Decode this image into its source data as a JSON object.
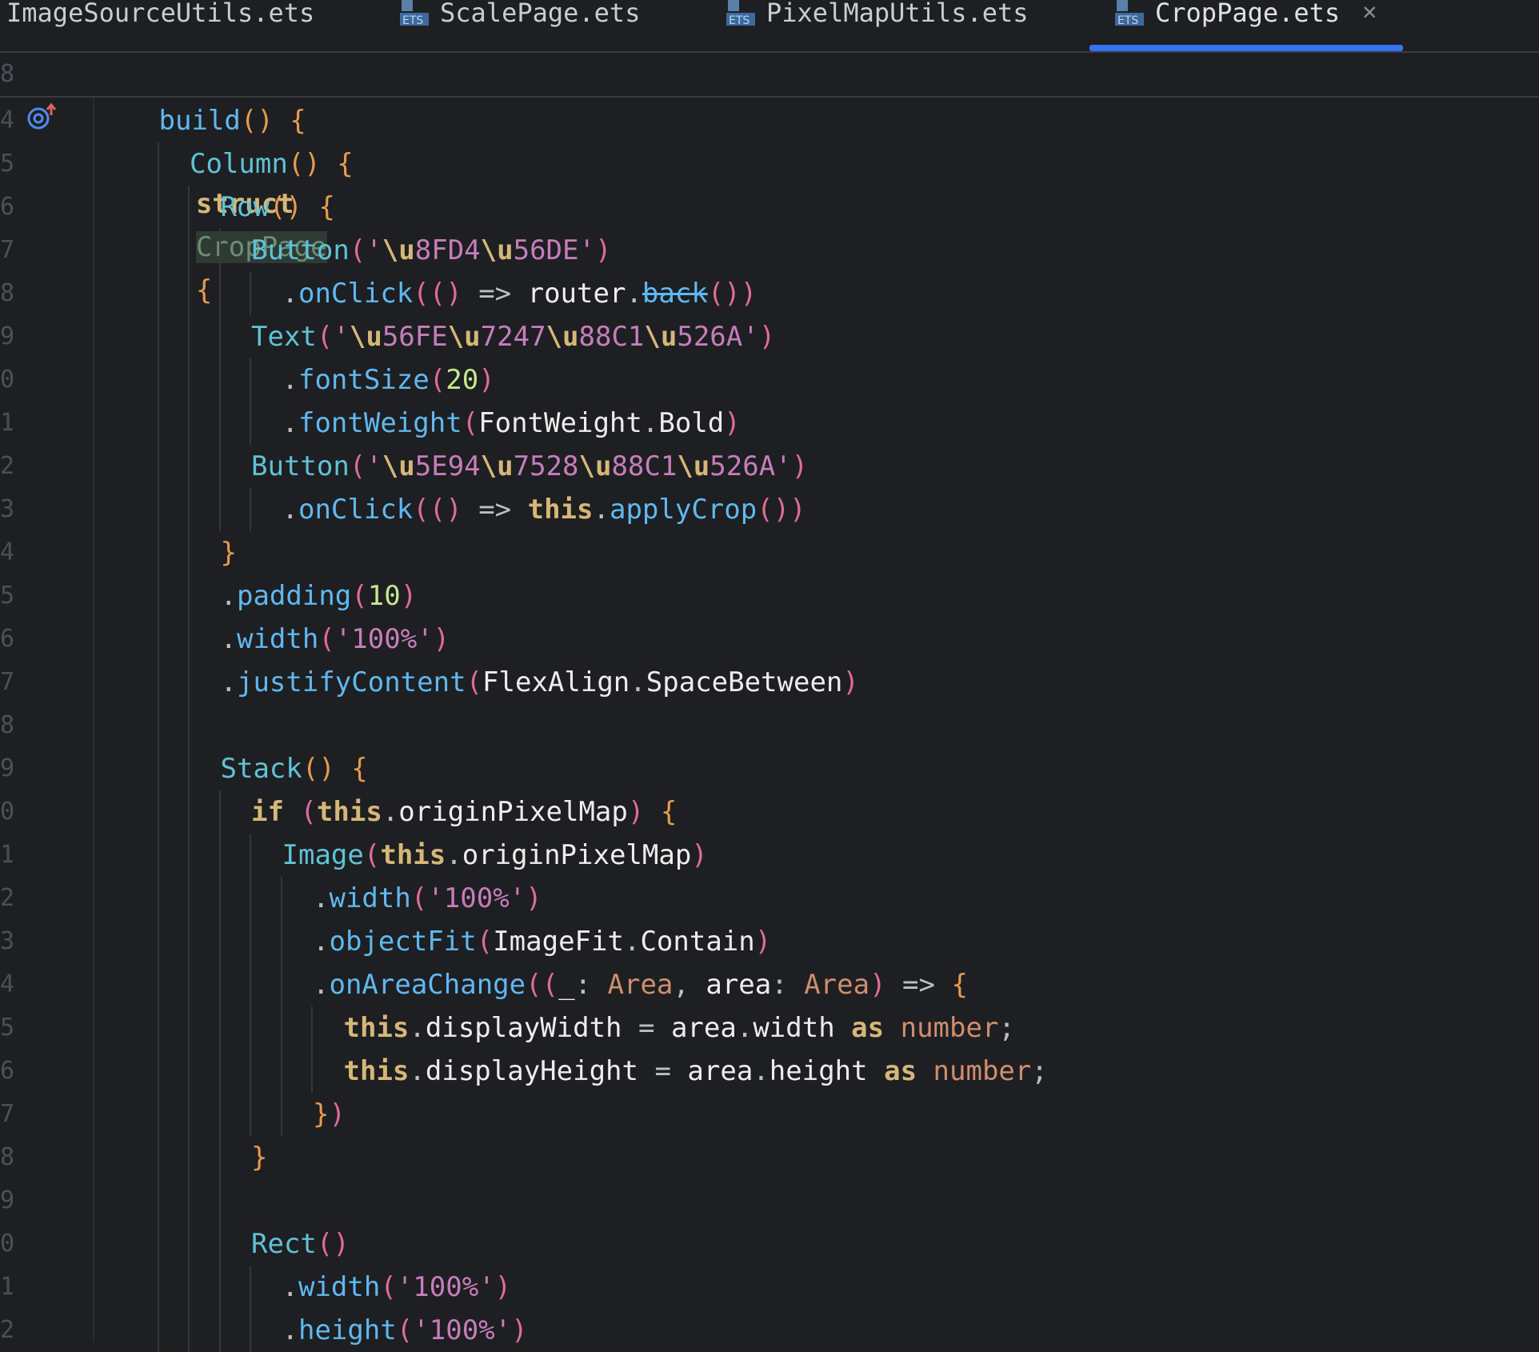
{
  "tabs": [
    {
      "label": "ImageSourceUtils.ets",
      "active": false
    },
    {
      "label": "ScalePage.ets",
      "active": false
    },
    {
      "label": "PixelMapUtils.ets",
      "active": false
    },
    {
      "label": "CropPage.ets",
      "active": true
    }
  ],
  "icons": {
    "file": "ets-file-icon",
    "close": "close-icon",
    "gutter": "implemented-method-icon"
  },
  "colors": {
    "accent": "#3574f0",
    "background": "#1e1f22"
  },
  "sticky": {
    "line_number": "8",
    "keyword": "struct",
    "name": "CropPage",
    "brace": "{"
  },
  "lines": [
    {
      "n": "4",
      "indent": 1,
      "tokens": [
        [
          "build",
          "mt"
        ],
        [
          "()",
          "br1"
        ],
        [
          " ",
          ""
        ],
        [
          "{",
          "br1"
        ]
      ]
    },
    {
      "n": "5",
      "indent": 2,
      "tokens": [
        [
          "Column",
          "cl"
        ],
        [
          "()",
          "br1"
        ],
        [
          " ",
          ""
        ],
        [
          "{",
          "br1"
        ]
      ]
    },
    {
      "n": "6",
      "indent": 3,
      "tokens": [
        [
          "Row",
          "cl"
        ],
        [
          "()",
          "br1"
        ],
        [
          " ",
          ""
        ],
        [
          "{",
          "br1"
        ]
      ]
    },
    {
      "n": "7",
      "indent": 4,
      "tokens": [
        [
          "Button",
          "cl"
        ],
        [
          "(",
          "br2"
        ],
        [
          "'",
          "str"
        ],
        [
          "\\u",
          "esc"
        ],
        [
          "8FD4",
          "str"
        ],
        [
          "\\u",
          "esc"
        ],
        [
          "56DE",
          "str"
        ],
        [
          "'",
          "str"
        ],
        [
          ")",
          "br2"
        ]
      ]
    },
    {
      "n": "8",
      "indent": 5,
      "tokens": [
        [
          ".",
          "op"
        ],
        [
          "onClick",
          "mt"
        ],
        [
          "((",
          "br2"
        ],
        [
          ")",
          "br2"
        ],
        [
          " => ",
          ""
        ],
        [
          "router",
          "id"
        ],
        [
          ".",
          "op"
        ],
        [
          "back",
          "dep"
        ],
        [
          "())",
          "br2"
        ]
      ]
    },
    {
      "n": "9",
      "indent": 4,
      "tokens": [
        [
          "Text",
          "cl"
        ],
        [
          "(",
          "br2"
        ],
        [
          "'",
          "str"
        ],
        [
          "\\u",
          "esc"
        ],
        [
          "56FE",
          "str"
        ],
        [
          "\\u",
          "esc"
        ],
        [
          "7247",
          "str"
        ],
        [
          "\\u",
          "esc"
        ],
        [
          "88C1",
          "str"
        ],
        [
          "\\u",
          "esc"
        ],
        [
          "526A",
          "str"
        ],
        [
          "'",
          "str"
        ],
        [
          ")",
          "br2"
        ]
      ]
    },
    {
      "n": "0",
      "indent": 5,
      "tokens": [
        [
          ".",
          "op"
        ],
        [
          "fontSize",
          "mt"
        ],
        [
          "(",
          "br2"
        ],
        [
          "20",
          "num"
        ],
        [
          ")",
          "br2"
        ]
      ]
    },
    {
      "n": "1",
      "indent": 5,
      "tokens": [
        [
          ".",
          "op"
        ],
        [
          "fontWeight",
          "mt"
        ],
        [
          "(",
          "br2"
        ],
        [
          "FontWeight",
          "id"
        ],
        [
          ".",
          "op"
        ],
        [
          "Bold",
          "id"
        ],
        [
          ")",
          "br2"
        ]
      ]
    },
    {
      "n": "2",
      "indent": 4,
      "tokens": [
        [
          "Button",
          "cl"
        ],
        [
          "(",
          "br2"
        ],
        [
          "'",
          "str"
        ],
        [
          "\\u",
          "esc"
        ],
        [
          "5E94",
          "str"
        ],
        [
          "\\u",
          "esc"
        ],
        [
          "7528",
          "str"
        ],
        [
          "\\u",
          "esc"
        ],
        [
          "88C1",
          "str"
        ],
        [
          "\\u",
          "esc"
        ],
        [
          "526A",
          "str"
        ],
        [
          "'",
          "str"
        ],
        [
          ")",
          "br2"
        ]
      ]
    },
    {
      "n": "3",
      "indent": 5,
      "tokens": [
        [
          ".",
          "op"
        ],
        [
          "onClick",
          "mt"
        ],
        [
          "((",
          "br2"
        ],
        [
          ")",
          "br2"
        ],
        [
          " => ",
          ""
        ],
        [
          "this",
          "kw"
        ],
        [
          ".",
          "op"
        ],
        [
          "applyCrop",
          "mt"
        ],
        [
          "())",
          "br2"
        ]
      ]
    },
    {
      "n": "4",
      "indent": 3,
      "tokens": [
        [
          "}",
          "br1"
        ]
      ]
    },
    {
      "n": "5",
      "indent": 3,
      "tokens": [
        [
          ".",
          "op"
        ],
        [
          "padding",
          "mt"
        ],
        [
          "(",
          "br2"
        ],
        [
          "10",
          "num"
        ],
        [
          ")",
          "br2"
        ]
      ]
    },
    {
      "n": "6",
      "indent": 3,
      "tokens": [
        [
          ".",
          "op"
        ],
        [
          "width",
          "mt"
        ],
        [
          "(",
          "br2"
        ],
        [
          "'100%'",
          "str"
        ],
        [
          ")",
          "br2"
        ]
      ]
    },
    {
      "n": "7",
      "indent": 3,
      "tokens": [
        [
          ".",
          "op"
        ],
        [
          "justifyContent",
          "mt"
        ],
        [
          "(",
          "br2"
        ],
        [
          "FlexAlign",
          "id"
        ],
        [
          ".",
          "op"
        ],
        [
          "SpaceBetween",
          "id"
        ],
        [
          ")",
          "br2"
        ]
      ]
    },
    {
      "n": "8",
      "indent": 3,
      "tokens": []
    },
    {
      "n": "9",
      "indent": 3,
      "tokens": [
        [
          "Stack",
          "cl"
        ],
        [
          "()",
          "br1"
        ],
        [
          " ",
          ""
        ],
        [
          "{",
          "br1"
        ]
      ]
    },
    {
      "n": "0",
      "indent": 4,
      "tokens": [
        [
          "if",
          "kw"
        ],
        [
          " ",
          ""
        ],
        [
          "(",
          "br2"
        ],
        [
          "this",
          "kw"
        ],
        [
          ".",
          "op"
        ],
        [
          "originPixelMap",
          "id"
        ],
        [
          ")",
          "br2"
        ],
        [
          " ",
          ""
        ],
        [
          "{",
          "br1"
        ]
      ]
    },
    {
      "n": "1",
      "indent": 5,
      "tokens": [
        [
          "Image",
          "cl"
        ],
        [
          "(",
          "br2"
        ],
        [
          "this",
          "kw"
        ],
        [
          ".",
          "op"
        ],
        [
          "originPixelMap",
          "id"
        ],
        [
          ")",
          "br2"
        ]
      ]
    },
    {
      "n": "2",
      "indent": 6,
      "tokens": [
        [
          ".",
          "op"
        ],
        [
          "width",
          "mt"
        ],
        [
          "(",
          "br2"
        ],
        [
          "'100%'",
          "str"
        ],
        [
          ")",
          "br2"
        ]
      ]
    },
    {
      "n": "3",
      "indent": 6,
      "tokens": [
        [
          ".",
          "op"
        ],
        [
          "objectFit",
          "mt"
        ],
        [
          "(",
          "br2"
        ],
        [
          "ImageFit",
          "id"
        ],
        [
          ".",
          "op"
        ],
        [
          "Contain",
          "id"
        ],
        [
          ")",
          "br2"
        ]
      ]
    },
    {
      "n": "4",
      "indent": 6,
      "tokens": [
        [
          ".",
          "op"
        ],
        [
          "onAreaChange",
          "mt"
        ],
        [
          "((",
          "br2"
        ],
        [
          "_",
          "id"
        ],
        [
          ": ",
          ""
        ],
        [
          "Area",
          "ty"
        ],
        [
          ", ",
          ""
        ],
        [
          "area",
          "id"
        ],
        [
          ": ",
          ""
        ],
        [
          "Area",
          "ty"
        ],
        [
          ")",
          "br2"
        ],
        [
          " => ",
          ""
        ],
        [
          "{",
          "br1"
        ]
      ]
    },
    {
      "n": "5",
      "indent": 7,
      "tokens": [
        [
          "this",
          "kw"
        ],
        [
          ".",
          "op"
        ],
        [
          "displayWidth",
          "id"
        ],
        [
          " = ",
          ""
        ],
        [
          "area",
          "id"
        ],
        [
          ".",
          "op"
        ],
        [
          "width",
          "id"
        ],
        [
          " ",
          ""
        ],
        [
          "as",
          "kw"
        ],
        [
          " ",
          ""
        ],
        [
          "number",
          "ty"
        ],
        [
          ";",
          ""
        ]
      ]
    },
    {
      "n": "6",
      "indent": 7,
      "tokens": [
        [
          "this",
          "kw"
        ],
        [
          ".",
          "op"
        ],
        [
          "displayHeight",
          "id"
        ],
        [
          " = ",
          ""
        ],
        [
          "area",
          "id"
        ],
        [
          ".",
          "op"
        ],
        [
          "height",
          "id"
        ],
        [
          " ",
          ""
        ],
        [
          "as",
          "kw"
        ],
        [
          " ",
          ""
        ],
        [
          "number",
          "ty"
        ],
        [
          ";",
          ""
        ]
      ]
    },
    {
      "n": "7",
      "indent": 6,
      "tokens": [
        [
          "}",
          "br1"
        ],
        [
          ")",
          "br2"
        ]
      ]
    },
    {
      "n": "8",
      "indent": 4,
      "tokens": [
        [
          "}",
          "br1"
        ]
      ]
    },
    {
      "n": "9",
      "indent": 4,
      "tokens": []
    },
    {
      "n": "0",
      "indent": 4,
      "tokens": [
        [
          "Rect",
          "cl"
        ],
        [
          "()",
          "br2"
        ]
      ]
    },
    {
      "n": "1",
      "indent": 5,
      "tokens": [
        [
          ".",
          "op"
        ],
        [
          "width",
          "mt"
        ],
        [
          "(",
          "br2"
        ],
        [
          "'100%'",
          "str"
        ],
        [
          ")",
          "br2"
        ]
      ]
    },
    {
      "n": "2",
      "indent": 5,
      "tokens": [
        [
          ".",
          "op"
        ],
        [
          "height",
          "mt"
        ],
        [
          "(",
          "br2"
        ],
        [
          "'100%'",
          "str"
        ],
        [
          ")",
          "br2"
        ]
      ]
    }
  ]
}
